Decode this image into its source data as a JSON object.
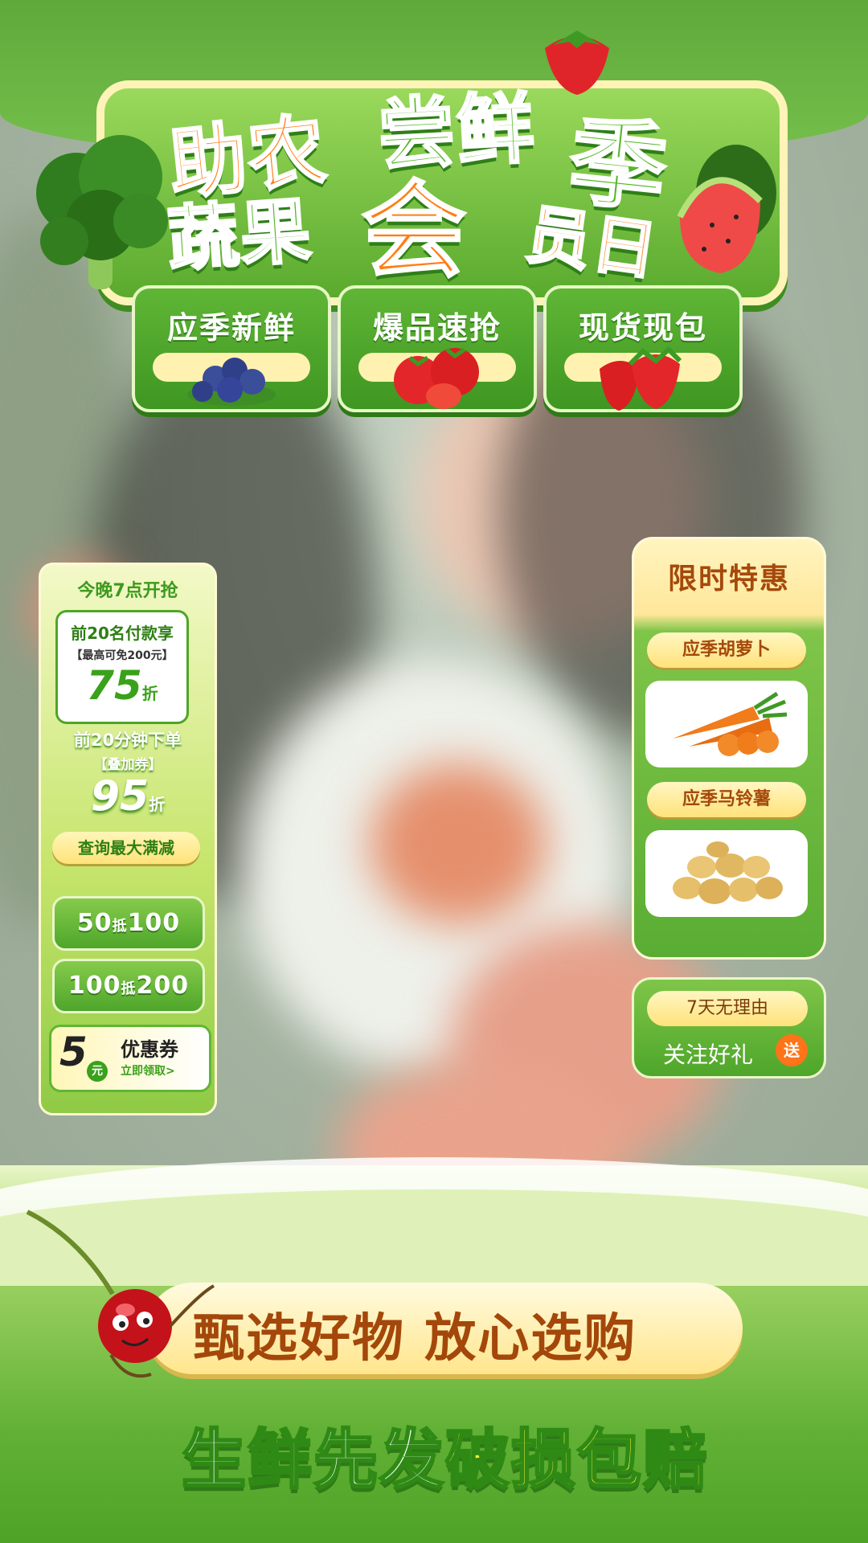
{
  "header": {
    "line1_a": "助农",
    "line1_b": "尝鲜",
    "line1_c": "季",
    "line2_a": "蔬果",
    "line2_b": "会",
    "line2_c": "员日"
  },
  "tags": [
    {
      "label": "应季新鲜",
      "icon": "blueberry-icon"
    },
    {
      "label": "爆品速抢",
      "icon": "tomato-icon"
    },
    {
      "label": "现货现包",
      "icon": "strawberry-icon"
    }
  ],
  "left_panel": {
    "headline": "今晚7点开抢",
    "box_line1": "前20名付款享",
    "box_line2": "【最高可免200元】",
    "box_discount": "75",
    "box_discount_unit": "折",
    "line2": "前20分钟下单",
    "line3": "【叠加券】",
    "discount2": "95",
    "discount2_unit": "折",
    "query_label": "查询最大满减",
    "deal1_a": "50",
    "deal1_b": "抵",
    "deal1_c": "100",
    "deal2_a": "100",
    "deal2_b": "抵",
    "deal2_c": "200",
    "coupon_value": "5",
    "coupon_unit": "元",
    "coupon_title": "优惠券",
    "coupon_action": "立即领取>"
  },
  "right_panel": {
    "title": "限时特惠",
    "item1": "应季胡萝卜",
    "item1_icon": "carrot-icon",
    "item2": "应季马铃薯",
    "item2_icon": "potato-icon"
  },
  "follow": {
    "pill": "7天无理由",
    "text": "关注好礼",
    "badge": "送"
  },
  "bottom": {
    "banner": "甄选好物 放心选购",
    "slogan_a": "生鲜先发",
    "slogan_b": "破损包赔"
  },
  "colors": {
    "brand_green": "#56b82a",
    "brand_orange": "#ff7e14",
    "cream": "#fff2b0",
    "brown_text": "#a5490b"
  }
}
